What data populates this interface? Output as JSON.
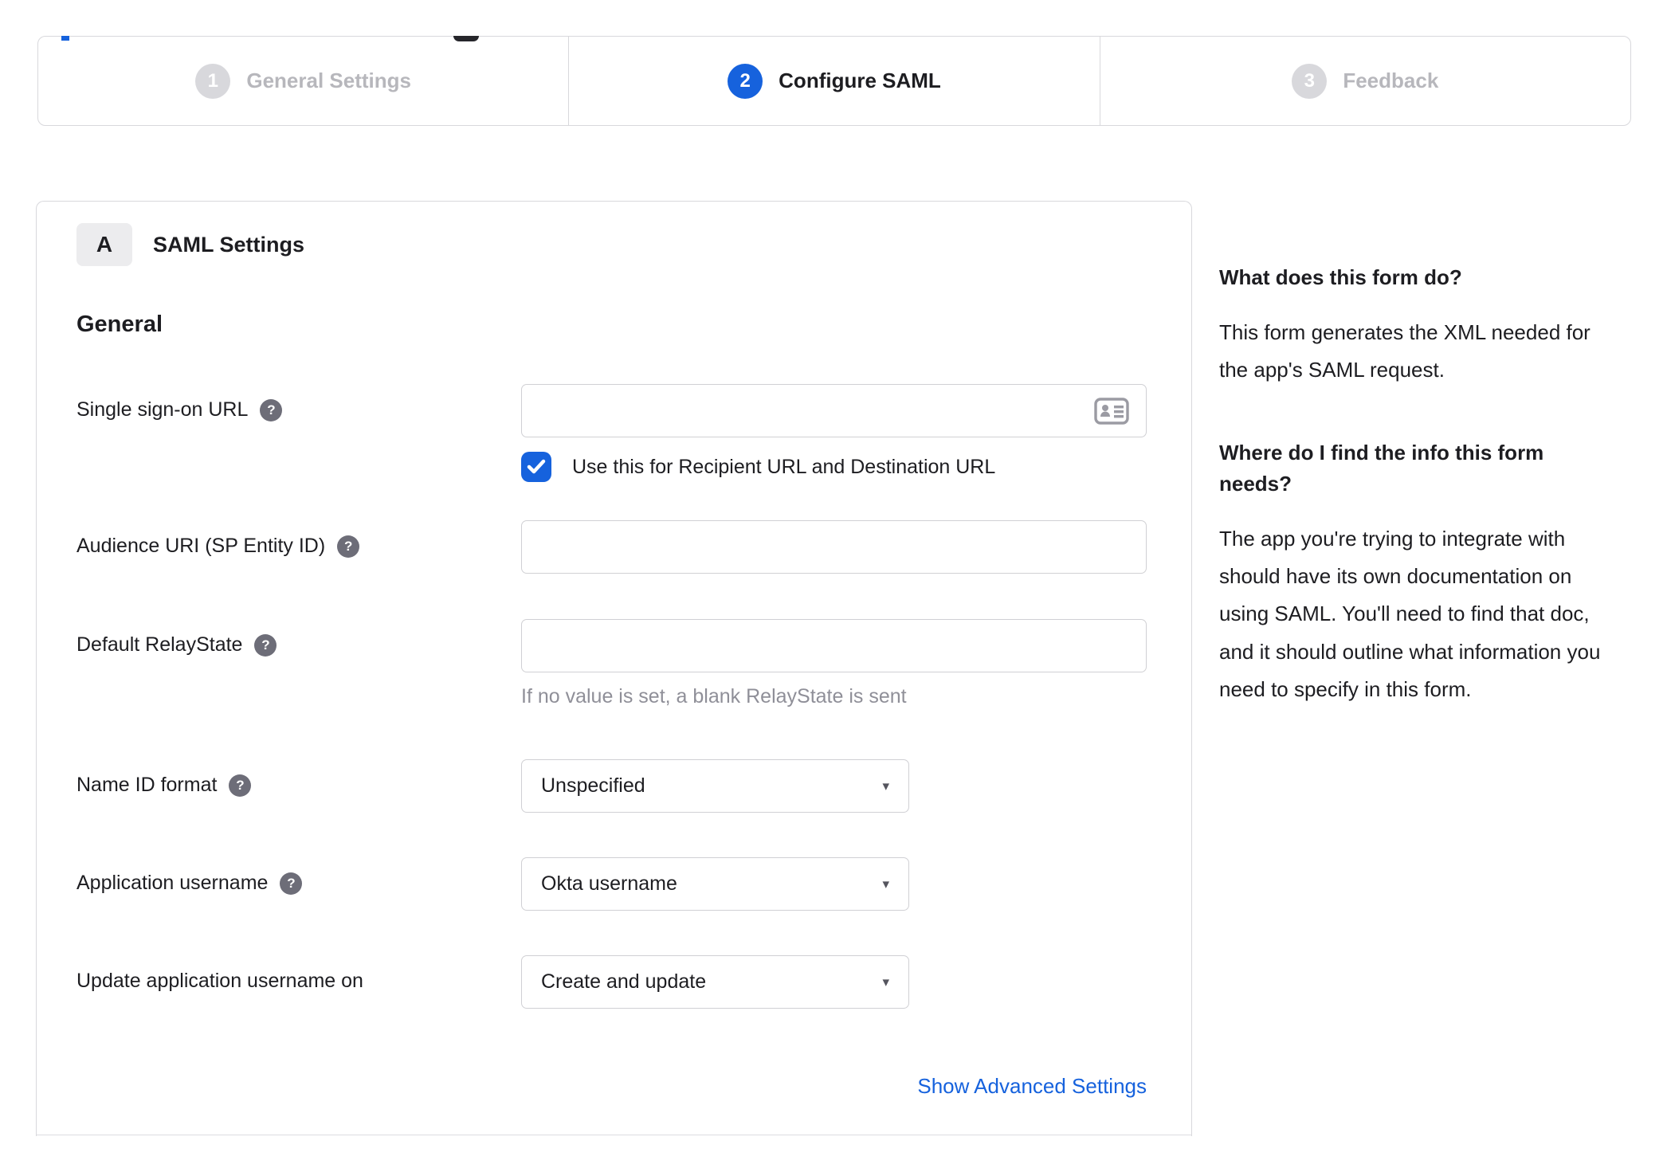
{
  "stepper": {
    "steps": [
      {
        "number": "1",
        "label": "General Settings",
        "state": "inactive"
      },
      {
        "number": "2",
        "label": "Configure SAML",
        "state": "active"
      },
      {
        "number": "3",
        "label": "Feedback",
        "state": "inactive"
      }
    ]
  },
  "panel": {
    "section_badge": "A",
    "section_title": "SAML Settings",
    "group_title": "General",
    "fields": [
      {
        "label": "Single sign-on URL",
        "type": "text",
        "value": "",
        "checkbox_label": "Use this for Recipient URL and Destination URL",
        "checkbox_checked": true
      },
      {
        "label": "Audience URI (SP Entity ID)",
        "type": "text",
        "value": ""
      },
      {
        "label": "Default RelayState",
        "type": "text",
        "value": "",
        "hint": "If no value is set, a blank RelayState is sent"
      },
      {
        "label": "Name ID format",
        "type": "select",
        "value": "Unspecified"
      },
      {
        "label": "Application username",
        "type": "select",
        "value": "Okta username"
      },
      {
        "label": "Update application username on",
        "type": "select",
        "value": "Create and update"
      }
    ],
    "advanced_link": "Show Advanced Settings"
  },
  "sidebar": {
    "blocks": [
      {
        "heading": "What does this form do?",
        "body": "This form generates the XML needed for the app's SAML request."
      },
      {
        "heading": "Where do I find the info this form needs?",
        "body": "The app you're trying to integrate with should have its own documentation on using SAML. You'll need to find that doc, and it should outline what information you need to specify in this form."
      }
    ]
  },
  "icons": {
    "help": "?",
    "caret": "▾"
  },
  "colors": {
    "accent_blue": "#1662dd",
    "link_blue": "#1662dd",
    "border_gray": "#d8d8dc",
    "input_border": "#d0d0d4",
    "text_dark": "#1d1d21",
    "hint_gray": "#8f8f98",
    "inactive_gray": "#b7b7bc",
    "badge_bg": "#ececee",
    "help_bg": "#6d6d78"
  }
}
